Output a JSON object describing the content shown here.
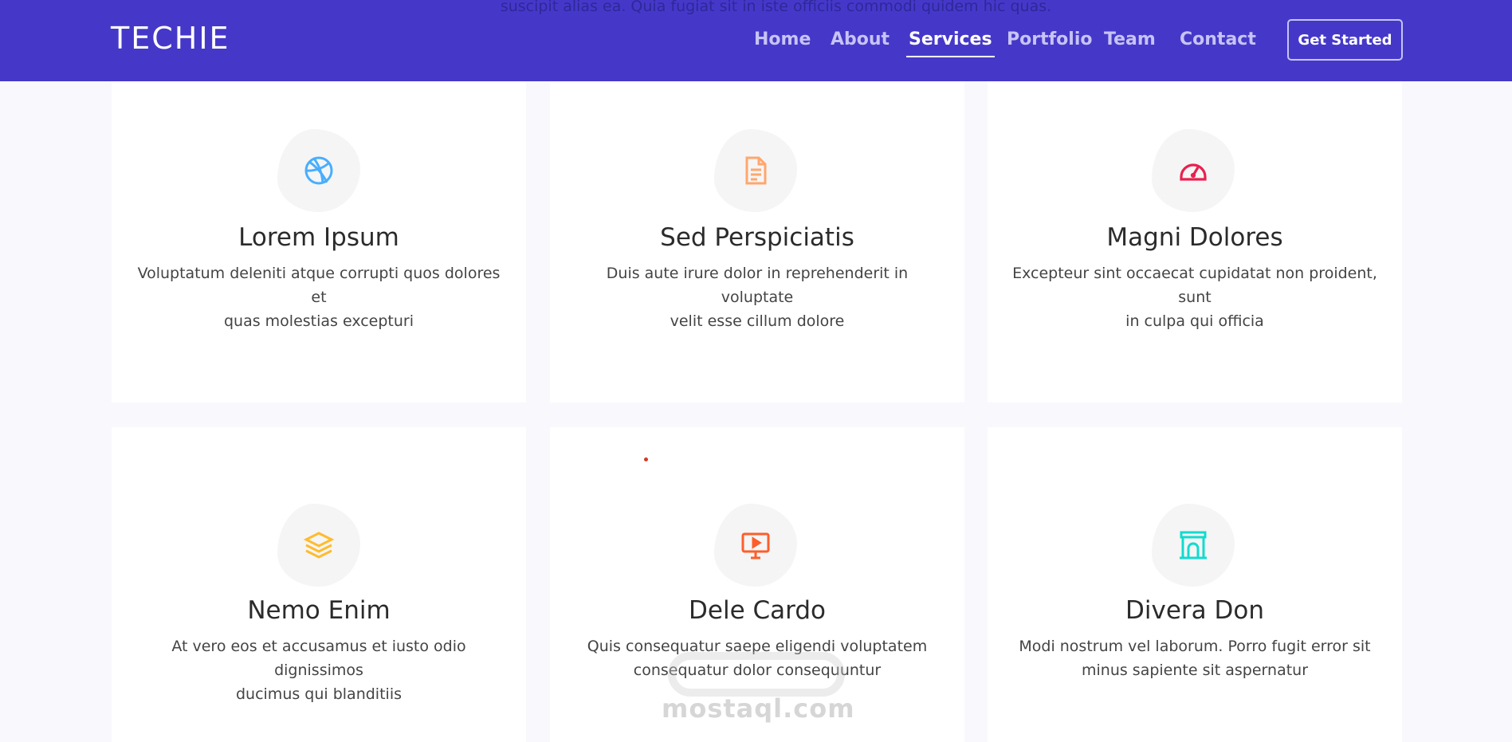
{
  "header": {
    "behind_text": "suscipit alias ea. Quia fugiat sit in iste officiis commodi quidem hic quas.",
    "logo": "TECHIE",
    "nav": [
      {
        "label": "Home",
        "active": false
      },
      {
        "label": "About",
        "active": false
      },
      {
        "label": "Services",
        "active": true
      },
      {
        "label": "Portfolio",
        "active": false
      },
      {
        "label": "Team",
        "active": false
      },
      {
        "label": "Contact",
        "active": false
      }
    ],
    "cta_label": "Get Started"
  },
  "services": [
    {
      "icon": "dribbble-icon",
      "color": "#47aeff",
      "title": "Lorem Ipsum",
      "text_line1": "Voluptatum deleniti atque corrupti quos dolores et",
      "text_line2": "quas molestias excepturi"
    },
    {
      "icon": "file-text-icon",
      "color": "#ffa76e",
      "title": "Sed Perspiciatis",
      "text_line1": "Duis aute irure dolor in reprehenderit in voluptate",
      "text_line2": "velit esse cillum dolore"
    },
    {
      "icon": "speedometer-icon",
      "color": "#e9204f",
      "title": "Magni Dolores",
      "text_line1": "Excepteur sint occaecat cupidatat non proident, sunt",
      "text_line2": "in culpa qui officia"
    },
    {
      "icon": "layers-icon",
      "color": "#ffbb2c",
      "title": "Nemo Enim",
      "text_line1": "At vero eos et accusamus et iusto odio dignissimos",
      "text_line2": "ducimus qui blanditiis"
    },
    {
      "icon": "presentation-icon",
      "color": "#fd5e2b",
      "title": "Dele Cardo",
      "text_line1": "Quis consequatur saepe eligendi voluptatem",
      "text_line2": "consequatur dolor consequuntur"
    },
    {
      "icon": "arch-icon",
      "color": "#11dbcf",
      "title": "Divera Don",
      "text_line1": "Modi nostrum vel laborum. Porro fugit error sit",
      "text_line2": "minus sapiente sit aspernatur"
    }
  ],
  "watermark": "mostaql.com"
}
